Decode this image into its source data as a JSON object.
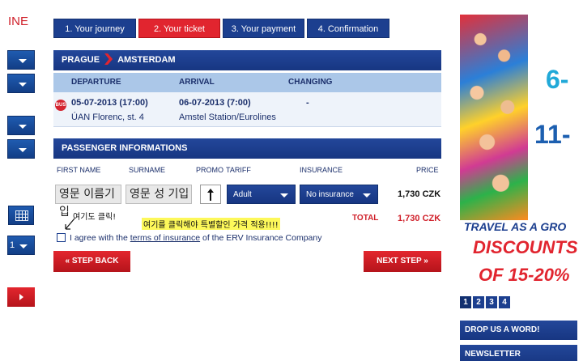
{
  "left": {
    "logo": "INE",
    "select_value": "1"
  },
  "steps": [
    {
      "label": "1.  Your journey",
      "active": false
    },
    {
      "label": "2.  Your ticket",
      "active": true
    },
    {
      "label": "3.  Your payment",
      "active": false
    },
    {
      "label": "4.  Confirmation",
      "active": false
    }
  ],
  "route": {
    "from": "PRAGUE",
    "to": "AMSTERDAM"
  },
  "journey": {
    "headers": {
      "departure": "DEPARTURE",
      "arrival": "ARRIVAL",
      "changing": "CHANGING"
    },
    "departure_time": "05-07-2013 (17:00)",
    "arrival_time": "06-07-2013 (7:00)",
    "changing": "-",
    "departure_place": "ÚAN Florenc, st. 4",
    "arrival_place": "Amstel Station/Eurolines",
    "bus_badge": "BUS"
  },
  "passenger": {
    "title": "PASSENGER INFORMATIONS",
    "columns": {
      "first_name": "FIRST NAME",
      "surname": "SURNAME",
      "promo": "PROMO",
      "tariff": "TARIFF",
      "insurance": "INSURANCE",
      "price": "PRICE"
    },
    "first_name_value": "영문 이름기입",
    "surname_value": "영문 성 기입",
    "tariff_value": "Adult",
    "insurance_value": "No insurance",
    "price_value": "1,730 CZK",
    "total_label": "TOTAL",
    "total_value": "1,730 CZK"
  },
  "annotations": {
    "click_here": "여기도 클릭!",
    "promo_note": "여기를 클릭해야 특별할인 가격 적용!!!!"
  },
  "agree": {
    "prefix": "I agree with the ",
    "link": "terms of insurance",
    "suffix": " of the ERV Insurance Company"
  },
  "buttons": {
    "back": "« STEP BACK",
    "next": "NEXT STEP »"
  },
  "ad": {
    "big_six": "6-",
    "big_eleven": "11-",
    "travel": "TRAVEL AS A GRO",
    "discounts": "DISCOUNTS",
    "of": "OF 15-20%",
    "pages": [
      "1",
      "2",
      "3",
      "4"
    ]
  },
  "sidebar": {
    "drop_word": "DROP US A WORD!",
    "newsletter": "NEWSLETTER"
  },
  "colors": {
    "navy": "#1c3f8f",
    "red": "#e1252f",
    "light_blue": "#abc7e8"
  }
}
